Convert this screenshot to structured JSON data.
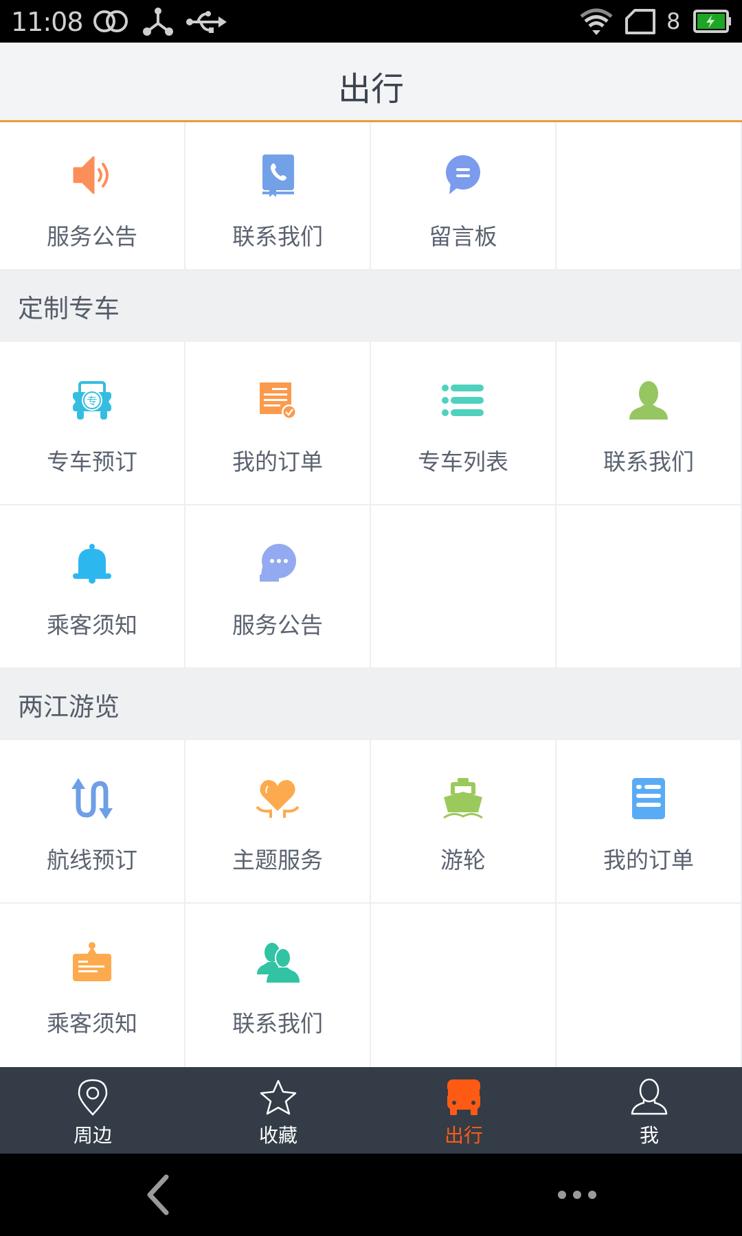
{
  "status_bar": {
    "time": "11:08",
    "icons": [
      "dual-sim-icon",
      "share-hub-icon",
      "usb-icon",
      "wifi-icon",
      "sim-card-icon",
      "battery-charging-icon"
    ],
    "signal_text": "8",
    "battery_color": "#1fa526"
  },
  "app_bar": {
    "title": "出行",
    "accent_color": "#ec9a3a"
  },
  "top_group": {
    "items": [
      {
        "label": "服务公告",
        "icon": "speaker-icon",
        "color": "#fc8e5a"
      },
      {
        "label": "联系我们",
        "icon": "phone-book-icon",
        "color": "#73a1e8"
      },
      {
        "label": "留言板",
        "icon": "message-board-icon",
        "color": "#7b9bec"
      }
    ]
  },
  "sections": [
    {
      "title": "定制专车",
      "items": [
        {
          "label": "专车预订",
          "icon": "car-booking-icon",
          "color": "#35bde0"
        },
        {
          "label": "我的订单",
          "icon": "order-check-icon",
          "color": "#fb9a4d"
        },
        {
          "label": "专车列表",
          "icon": "list-icon",
          "color": "#4fd1bd"
        },
        {
          "label": "联系我们",
          "icon": "contact-person-icon",
          "color": "#95c661"
        },
        {
          "label": "乘客须知",
          "icon": "bell-icon",
          "color": "#2db7ef"
        },
        {
          "label": "服务公告",
          "icon": "chat-bubble-icon",
          "color": "#94aaf0"
        }
      ]
    },
    {
      "title": "两江游览",
      "items": [
        {
          "label": "航线预订",
          "icon": "route-arrows-icon",
          "color": "#6e9fe6"
        },
        {
          "label": "主题服务",
          "icon": "heart-hands-icon",
          "color": "#fdaa4f"
        },
        {
          "label": "游轮",
          "icon": "cruise-ship-icon",
          "color": "#9cc95c"
        },
        {
          "label": "我的订单",
          "icon": "order-doc-icon",
          "color": "#5aabf5"
        },
        {
          "label": "乘客须知",
          "icon": "notice-sign-icon",
          "color": "#fdaa4f"
        },
        {
          "label": "联系我们",
          "icon": "contacts-group-icon",
          "color": "#31c3a3"
        }
      ]
    }
  ],
  "tab_bar": {
    "active_color": "#ff5a14",
    "tabs": [
      {
        "label": "周边",
        "icon": "location-pin-icon",
        "active": false
      },
      {
        "label": "收藏",
        "icon": "star-icon",
        "active": false
      },
      {
        "label": "出行",
        "icon": "bus-icon",
        "active": true
      },
      {
        "label": "我",
        "icon": "user-icon",
        "active": false
      }
    ]
  },
  "system_nav": {
    "back": "back-icon",
    "more": "more-icon"
  }
}
